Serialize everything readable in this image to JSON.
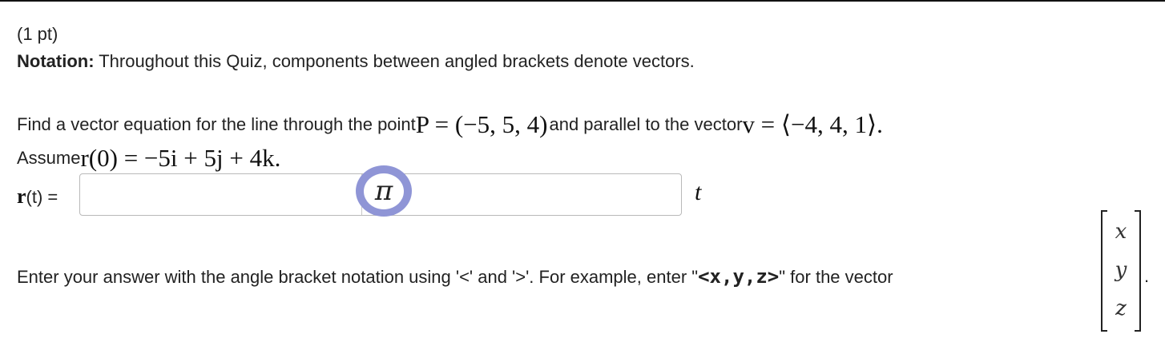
{
  "points": "(1 pt)",
  "notation": {
    "label": "Notation:",
    "text": " Throughout this Quiz, components between angled brackets denote vectors."
  },
  "question": {
    "line1_prefix": "Find a vector equation for the line through the point ",
    "point_math": "P = (−5, 5, 4)",
    "line1_middle": " and parallel to the vector ",
    "vector_math": "v = ⟨−4, 4, 1⟩",
    "period": ".",
    "assume_label": "Assume ",
    "assume_math": "r(0) = −5i + 5j + 4k",
    "assume_end": "."
  },
  "answer": {
    "label_var": "r",
    "label_rest": "(t) =",
    "input_value": "",
    "pi_symbol": "π",
    "trailing_var": "t"
  },
  "instructions": {
    "prefix": "Enter your answer with the angle bracket notation using '<' and '>'. For example, enter \"",
    "example": "<x,y,z>",
    "suffix": "\" for the vector",
    "matrix": [
      "x",
      "y",
      "z"
    ],
    "end": "."
  }
}
